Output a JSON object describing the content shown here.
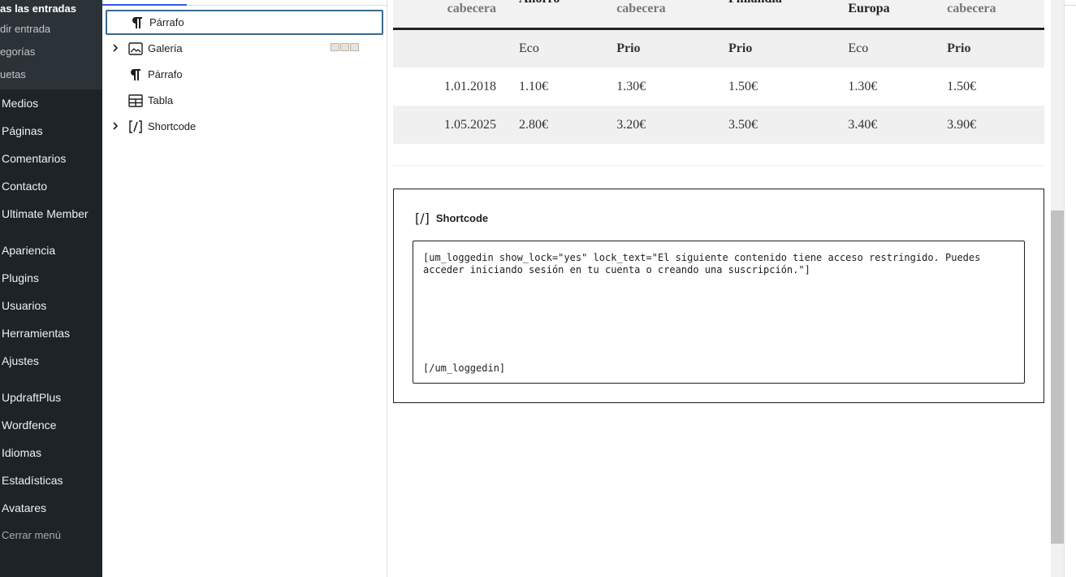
{
  "sidebar": {
    "submenu": [
      "as las entradas",
      "dir entrada",
      "egorías",
      "uetas"
    ],
    "menu_group1": [
      "Medios",
      "Páginas",
      "Comentarios",
      "Contacto",
      "Ultimate Member"
    ],
    "menu_group2": [
      "Apariencia",
      "Plugins",
      "Usuarios",
      "Herramientas",
      "Ajustes"
    ],
    "menu_group3": [
      "UpdraftPlus",
      "Wordfence",
      "Idiomas",
      "Estadísticas",
      "Avatares"
    ],
    "collapse_label": "Cerrar menú"
  },
  "list_view": {
    "items": [
      {
        "label": "Párrafo",
        "icon": "paragraph-icon",
        "expandable": false,
        "selected": true
      },
      {
        "label": "Galería",
        "icon": "gallery-icon",
        "expandable": true,
        "selected": false
      },
      {
        "label": "Párrafo",
        "icon": "paragraph-icon",
        "expandable": false,
        "selected": false
      },
      {
        "label": "Tabla",
        "icon": "table-icon",
        "expandable": false,
        "selected": false
      },
      {
        "label": "Shortcode",
        "icon": "shortcode-icon",
        "expandable": true,
        "selected": false
      }
    ]
  },
  "table": {
    "header_cutoff": [
      "cabecera",
      "Ahorro",
      "cabecera",
      "Finlandia",
      "Europa",
      "cabecera"
    ],
    "subheader": [
      "",
      "Eco",
      "Prio",
      "Prio",
      "Eco",
      "Prio"
    ],
    "rows": [
      [
        "1.01.2018",
        "1.10€",
        "1.30€",
        "1.50€",
        "1.30€",
        "1.50€"
      ],
      [
        "1.05.2025",
        "2.80€",
        "3.20€",
        "3.50€",
        "3.40€",
        "3.90€"
      ]
    ]
  },
  "shortcode": {
    "title": "Shortcode",
    "icon_glyph": "[/]",
    "content_line1": "[um_loggedin show_lock=\"yes\" lock_text=\"El siguiente contenido tiene acceso restringido. Puedes",
    "content_line2": "acceder iniciando sesión en tu cuenta o creando una suscripción.\"]",
    "content_close": "[/um_loggedin]"
  },
  "colors": {
    "admin_sidebar": "#1d2327",
    "accent": "#3858e9"
  }
}
